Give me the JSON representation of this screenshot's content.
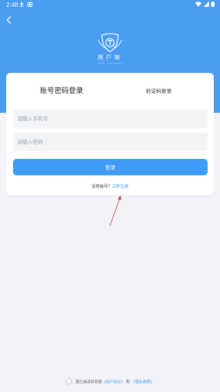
{
  "status_bar": {
    "time": "2:48"
  },
  "header": {
    "logo_title": "用户端",
    "logo_sub": "USER TERMINAL"
  },
  "login": {
    "tab_password": "账号密码登录",
    "tab_code": "验证码登录",
    "phone_placeholder": "请输入手机号",
    "password_placeholder": "请输入密码",
    "login_button": "登录",
    "no_account": "没有账号？",
    "register_link": "立即注册"
  },
  "agreement": {
    "prefix": "我已阅读并同意",
    "user_agreement": "《用户协议》",
    "and": "和",
    "privacy_policy": "《隐私政策》"
  },
  "colors": {
    "primary": "#3f9cf6",
    "header_bg": "#4a9cf0",
    "page_bg": "#f2f3f8",
    "annotation_arrow": "#d9362e"
  }
}
